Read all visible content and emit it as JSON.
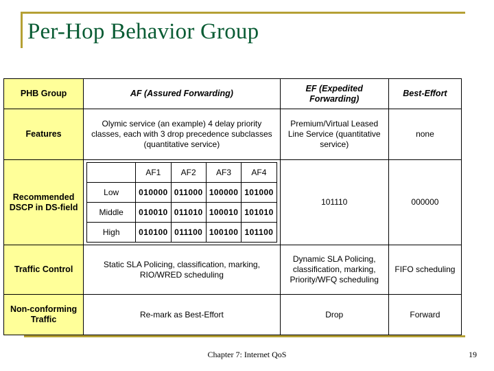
{
  "slide": {
    "title": "Per-Hop Behavior Group",
    "accent_color": "#b5a034",
    "title_color": "#0a5c34",
    "rowhead_fill": "#ffff99"
  },
  "table": {
    "columns": [
      {
        "label": "PHB Group"
      },
      {
        "label": "AF (Assured Forwarding)"
      },
      {
        "label": "EF (Expedited Forwarding)"
      },
      {
        "label": "Best-Effort"
      }
    ],
    "rows": [
      {
        "header": "Features",
        "af": "Olymic service (an example)\n4 delay priority classes, each with 3 drop precedence subclasses (quantitative service)",
        "ef": "Premium/Virtual Leased Line Service (quantitative service)",
        "be": "none"
      },
      {
        "header": "Recommended DSCP in DS-field",
        "ef": "101110",
        "be": "000000"
      },
      {
        "header": "Traffic Control",
        "af": "Static SLA\nPolicing, classification, marking, RIO/WRED scheduling",
        "ef": "Dynamic SLA Policing, classification, marking, Priority/WFQ scheduling",
        "be": "FIFO scheduling"
      },
      {
        "header": "Non-conforming Traffic",
        "af": "Re-mark as Best-Effort",
        "ef": "Drop",
        "be": "Forward"
      }
    ]
  },
  "dscp_table": {
    "class_headers": [
      "",
      "AF1",
      "AF2",
      "AF3",
      "AF4"
    ],
    "rows": [
      {
        "precedence": "Low",
        "codes": [
          "010000",
          "011000",
          "100000",
          "101000"
        ]
      },
      {
        "precedence": "Middle",
        "codes": [
          "010010",
          "011010",
          "100010",
          "101010"
        ]
      },
      {
        "precedence": "High",
        "codes": [
          "010100",
          "011100",
          "100100",
          "101100"
        ]
      }
    ]
  },
  "footer": {
    "center": "Chapter 7: Internet QoS",
    "page_number": "19"
  }
}
